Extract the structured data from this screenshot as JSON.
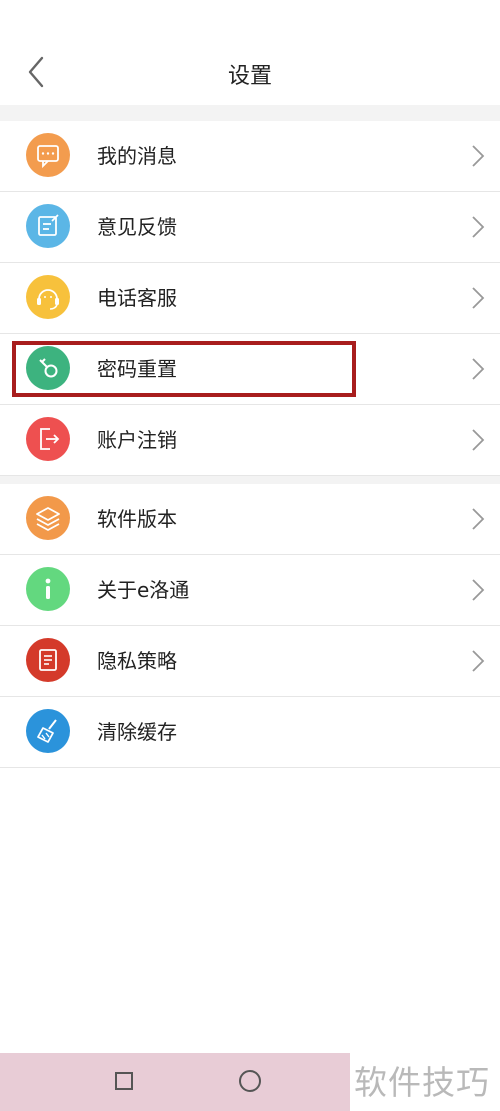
{
  "header": {
    "title": "设置"
  },
  "groups": [
    {
      "items": [
        {
          "label": "我的消息",
          "icon": "message-icon",
          "color": "#F39C4E"
        },
        {
          "label": "意见反馈",
          "icon": "feedback-icon",
          "color": "#5BB6E6"
        },
        {
          "label": "电话客服",
          "icon": "headset-icon",
          "color": "#F7C13C"
        },
        {
          "label": "密码重置",
          "icon": "key-icon",
          "color": "#3DB37F"
        },
        {
          "label": "账户注销",
          "icon": "logout-icon",
          "color": "#EE5050"
        }
      ]
    },
    {
      "items": [
        {
          "label": "软件版本",
          "icon": "layers-icon",
          "color": "#F2994A"
        },
        {
          "label": "关于e洛通",
          "icon": "info-icon",
          "color": "#63D87F"
        },
        {
          "label": "隐私策略",
          "icon": "document-icon",
          "color": "#D43A2A"
        },
        {
          "label": "清除缓存",
          "icon": "broom-icon",
          "color": "#2B93DB"
        }
      ]
    }
  ],
  "highlight_color": "#A81D1D",
  "watermark": "软件技巧"
}
